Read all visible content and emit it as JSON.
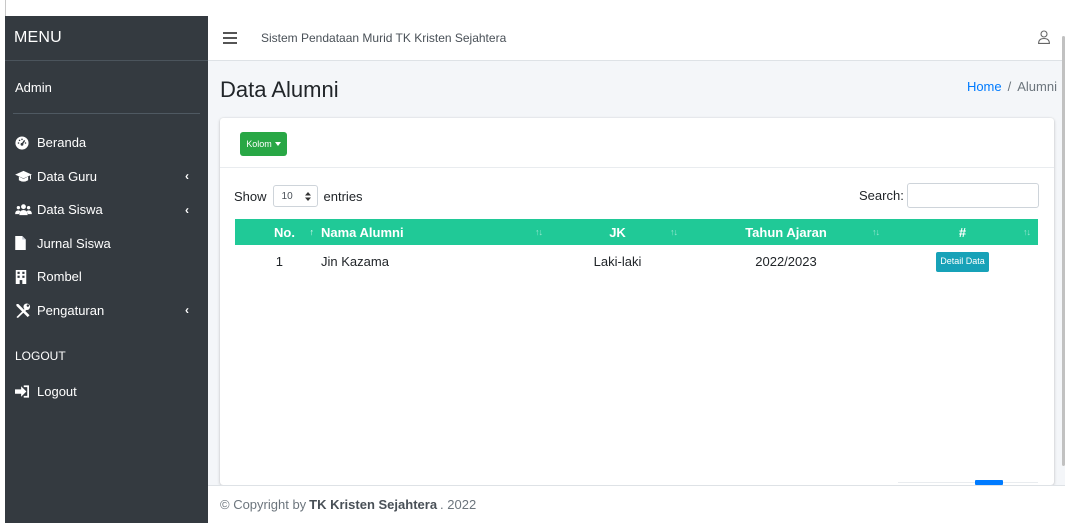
{
  "sidebar": {
    "brand": "MENU",
    "user": "Admin",
    "items": [
      {
        "label": "Beranda",
        "icon": "dashboard-icon"
      },
      {
        "label": "Data Guru",
        "icon": "graduation-cap-icon"
      },
      {
        "label": "Data Siswa",
        "icon": "users-icon"
      },
      {
        "label": "Jurnal Siswa",
        "icon": "file-icon"
      },
      {
        "label": "Rombel",
        "icon": "building-icon"
      },
      {
        "label": "Pengaturan",
        "icon": "tools-icon"
      }
    ],
    "section_header": "LOGOUT",
    "logout": {
      "label": "Logout",
      "icon": "sign-out-icon"
    }
  },
  "topbar": {
    "title": "Sistem Pendataan Murid TK Kristen Sejahtera"
  },
  "page": {
    "title": "Data Alumni",
    "breadcrumb": {
      "home": "Home",
      "separator": "/",
      "current": "Alumni"
    }
  },
  "card": {
    "kolom_button": "Kolom",
    "show_label": "Show",
    "entries_value": "10",
    "entries_label": "entries",
    "search_label": "Search:",
    "search_value": ""
  },
  "table": {
    "headers": {
      "no": "No.",
      "nama": "Nama Alumni",
      "jk": "JK",
      "tahun": "Tahun Ajaran",
      "act": "#"
    },
    "rows": [
      {
        "no": "1",
        "nama": "Jin Kazama",
        "jk": "Laki-laki",
        "tahun": "2022/2023",
        "action": "Detail Data"
      }
    ]
  },
  "footer": {
    "prefix": "© Copyright by",
    "brand": "TK Kristen Sejahtera",
    "suffix": ". 2022"
  },
  "colors": {
    "sidebar_bg": "#343a40",
    "table_header": "#20c997",
    "kolom_button": "#28a745",
    "detail_button": "#17a2b8",
    "link": "#007bff"
  }
}
